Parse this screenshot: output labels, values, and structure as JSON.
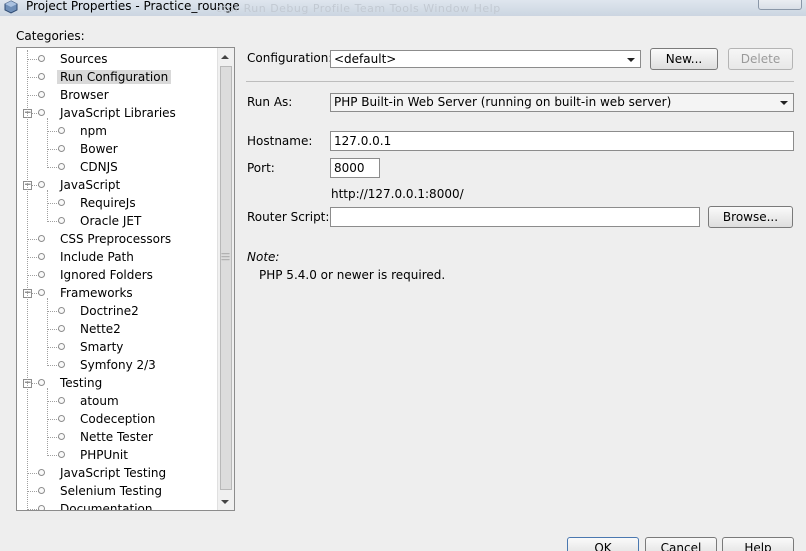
{
  "window": {
    "title": "Project Properties - Practice_rounge",
    "background_menu_ghost": "ctor Run Debug Profile Team Tools Window Help"
  },
  "categories": {
    "label": "Categories:",
    "items": [
      {
        "label": "Sources",
        "level": 0,
        "selected": false
      },
      {
        "label": "Run Configuration",
        "level": 0,
        "selected": true
      },
      {
        "label": "Browser",
        "level": 0,
        "selected": false
      },
      {
        "label": "JavaScript Libraries",
        "level": 0,
        "expandable": true
      },
      {
        "label": "npm",
        "level": 1
      },
      {
        "label": "Bower",
        "level": 1
      },
      {
        "label": "CDNJS",
        "level": 1
      },
      {
        "label": "JavaScript",
        "level": 0,
        "expandable": true
      },
      {
        "label": "RequireJs",
        "level": 1
      },
      {
        "label": "Oracle JET",
        "level": 1
      },
      {
        "label": "CSS Preprocessors",
        "level": 0
      },
      {
        "label": "Include Path",
        "level": 0
      },
      {
        "label": "Ignored Folders",
        "level": 0
      },
      {
        "label": "Frameworks",
        "level": 0,
        "expandable": true
      },
      {
        "label": "Doctrine2",
        "level": 1
      },
      {
        "label": "Nette2",
        "level": 1
      },
      {
        "label": "Smarty",
        "level": 1
      },
      {
        "label": "Symfony 2/3",
        "level": 1
      },
      {
        "label": "Testing",
        "level": 0,
        "expandable": true
      },
      {
        "label": "atoum",
        "level": 1
      },
      {
        "label": "Codeception",
        "level": 1
      },
      {
        "label": "Nette Tester",
        "level": 1
      },
      {
        "label": "PHPUnit",
        "level": 1
      },
      {
        "label": "JavaScript Testing",
        "level": 0
      },
      {
        "label": "Selenium Testing",
        "level": 0
      },
      {
        "label": "Documentation",
        "level": 0
      }
    ]
  },
  "config": {
    "configuration_label": "Configuration:",
    "configuration_value": "<default>",
    "new_button": "New...",
    "delete_button": "Delete",
    "run_as_label": "Run As:",
    "run_as_value": "PHP Built-in Web Server (running on built-in web server)",
    "hostname_label": "Hostname:",
    "hostname_value": "127.0.0.1",
    "port_label": "Port:",
    "port_value": "8000",
    "url_preview": "http://127.0.0.1:8000/",
    "router_label": "Router Script:",
    "router_value": "",
    "browse_button": "Browse...",
    "note_title": "Note:",
    "note_text": "PHP 5.4.0 or newer is required."
  },
  "footer": {
    "ok_button": "OK",
    "cancel_button": "Cancel",
    "help_button": "Help"
  }
}
